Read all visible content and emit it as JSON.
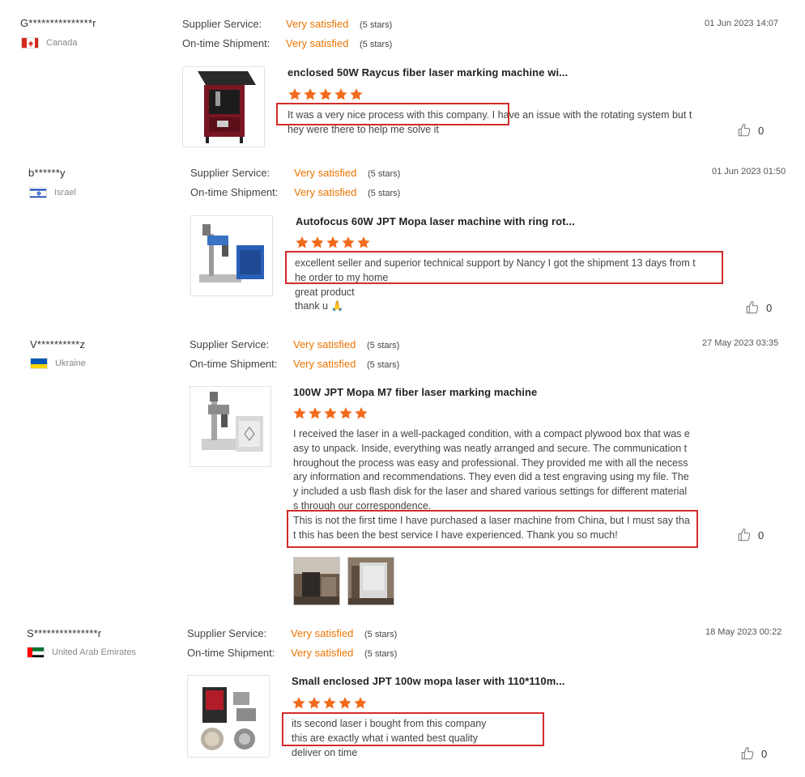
{
  "reviews": [
    {
      "user": "G***************r",
      "country": "Canada",
      "flag": "canada",
      "date": "01 Jun 2023 14:07",
      "supplier_label": "Supplier Service:",
      "supplier_value": "Very satisfied",
      "supplier_stars": "(5 stars)",
      "shipment_label": "On-time Shipment:",
      "shipment_value": "Very satisfied",
      "shipment_stars": "(5 stars)",
      "product_title": "enclosed 50W Raycus fiber laser marking machine wi...",
      "rating": 5,
      "lines": [
        "It was a very nice process with this company. I have an issue with the rotating system but they were there to help me solve it"
      ],
      "likes": "0"
    },
    {
      "user": "b******y",
      "country": "Israel",
      "flag": "israel",
      "date": "01 Jun 2023 01:50",
      "supplier_label": "Supplier Service:",
      "supplier_value": "Very satisfied",
      "supplier_stars": "(5 stars)",
      "shipment_label": "On-time Shipment:",
      "shipment_value": "Very satisfied",
      "shipment_stars": "(5 stars)",
      "product_title": "Autofocus 60W JPT Mopa laser machine with ring rot...",
      "rating": 5,
      "lines": [
        "excellent seller and superior technical support by Nancy I got the shipment 13 days from the order to my home",
        "great product",
        "thank u 🙏"
      ],
      "likes": "0"
    },
    {
      "user": "V**********z",
      "country": "Ukraine",
      "flag": "ukraine",
      "date": "27 May 2023 03:35",
      "supplier_label": "Supplier Service:",
      "supplier_value": "Very satisfied",
      "supplier_stars": "(5 stars)",
      "shipment_label": "On-time Shipment:",
      "shipment_value": "Very satisfied",
      "shipment_stars": "(5 stars)",
      "product_title": "100W JPT Mopa M7 fiber laser marking machine",
      "rating": 5,
      "lines": [
        "I received the laser in a well-packaged condition, with a compact plywood box that was easy to unpack. Inside, everything was neatly arranged and secure. The communication throughout the process was easy and professional. They provided me with all the necessary information and recommendations. They even did a test engraving using my file. They included a usb flash disk for the laser and shared various settings for different materials through our correspondence.",
        "This is not the first time I have purchased a laser machine from China, but I must say that this has been the best service I have experienced. Thank you so much!"
      ],
      "likes": "0"
    },
    {
      "user": "S***************r",
      "country": "United Arab Emirates",
      "flag": "uae",
      "date": "18 May 2023 00:22",
      "supplier_label": "Supplier Service:",
      "supplier_value": "Very satisfied",
      "supplier_stars": "(5 stars)",
      "shipment_label": "On-time Shipment:",
      "shipment_value": "Very satisfied",
      "shipment_stars": "(5 stars)",
      "product_title": "Small enclosed JPT 100w mopa laser with 110*110m...",
      "rating": 5,
      "lines": [
        "its second laser i bought from this company",
        "this are exactly what i wanted best quality",
        "deliver on time"
      ],
      "likes": "0"
    }
  ],
  "colors": {
    "accent": "#ec7300",
    "highlight_box": "#d22b2b",
    "star": "#f26a1b"
  },
  "icons": {
    "star": "star-icon",
    "like": "thumbs-up-icon"
  }
}
